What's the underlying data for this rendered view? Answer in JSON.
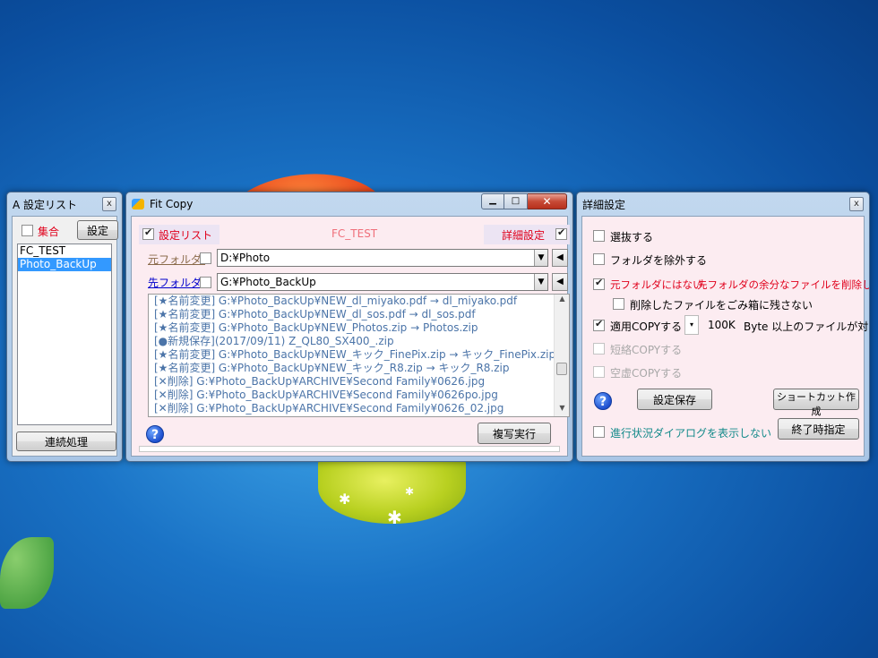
{
  "colors": {
    "accent_red": "#e0001b",
    "link_blue": "#0000cc",
    "log_text": "#4b74a8",
    "selection": "#3399ff",
    "teal_text": "#138a8a"
  },
  "settings_list_window": {
    "title": "A 設定リスト",
    "close_glyph": "x",
    "group_label": "集合",
    "settings_button": "設定",
    "items": [
      "FC_TEST",
      "Photo_BackUp"
    ],
    "selected_index": 1,
    "batch_button": "連続処理"
  },
  "fitcopy_window": {
    "title": "Fit Copy",
    "settings_list_label": "設定リスト",
    "profile_name": "FC_TEST",
    "detail_label": "詳細設定",
    "source_label": "元フォルダ:",
    "source_path": "D:¥Photo",
    "dest_label": "先フォルダ:",
    "dest_path": "G:¥Photo_BackUp",
    "log_lines": [
      "[★名前変更] G:¥Photo_BackUp¥NEW_dl_miyako.pdf → dl_miyako.pdf",
      "[★名前変更] G:¥Photo_BackUp¥NEW_dl_sos.pdf → dl_sos.pdf",
      "[★名前変更] G:¥Photo_BackUp¥NEW_Photos.zip → Photos.zip",
      "[●新規保存](2017/09/11) Z_QL80_SX400_.zip",
      "[★名前変更] G:¥Photo_BackUp¥NEW_キック_FinePix.zip → キック_FinePix.zip",
      "[★名前変更] G:¥Photo_BackUp¥NEW_キック_R8.zip → キック_R8.zip",
      "[✕削除] G:¥Photo_BackUp¥ARCHIVE¥Second Family¥0626.jpg",
      "[✕削除] G:¥Photo_BackUp¥ARCHIVE¥Second Family¥0626po.jpg",
      "[✕削除] G:¥Photo_BackUp¥ARCHIVE¥Second Family¥0626_02.jpg"
    ],
    "help_glyph": "?",
    "execute_button": "複写実行"
  },
  "detail_window": {
    "title": "詳細設定",
    "close_glyph": "x",
    "opt_select": "選抜する",
    "opt_exclude_folder": "フォルダを除外する",
    "opt_delete_a": "元フォルダにはない",
    "opt_delete_b": "先フォルダの余分なファイルを削除します",
    "opt_no_recycle": "削除したファイルをごみ箱に残さない",
    "opt_apply_copy": "適用COPYする",
    "size_value": "100K",
    "size_suffix": "Byte 以上のファイルが対象",
    "opt_short_copy": "短絡COPYする",
    "opt_empty_copy": "空虚COPYする",
    "help_glyph": "?",
    "save_button": "設定保存",
    "shortcut_button": "ショートカット作成",
    "opt_no_progress": "進行状況ダイアログを表示しない",
    "end_time_button": "終了時指定"
  }
}
